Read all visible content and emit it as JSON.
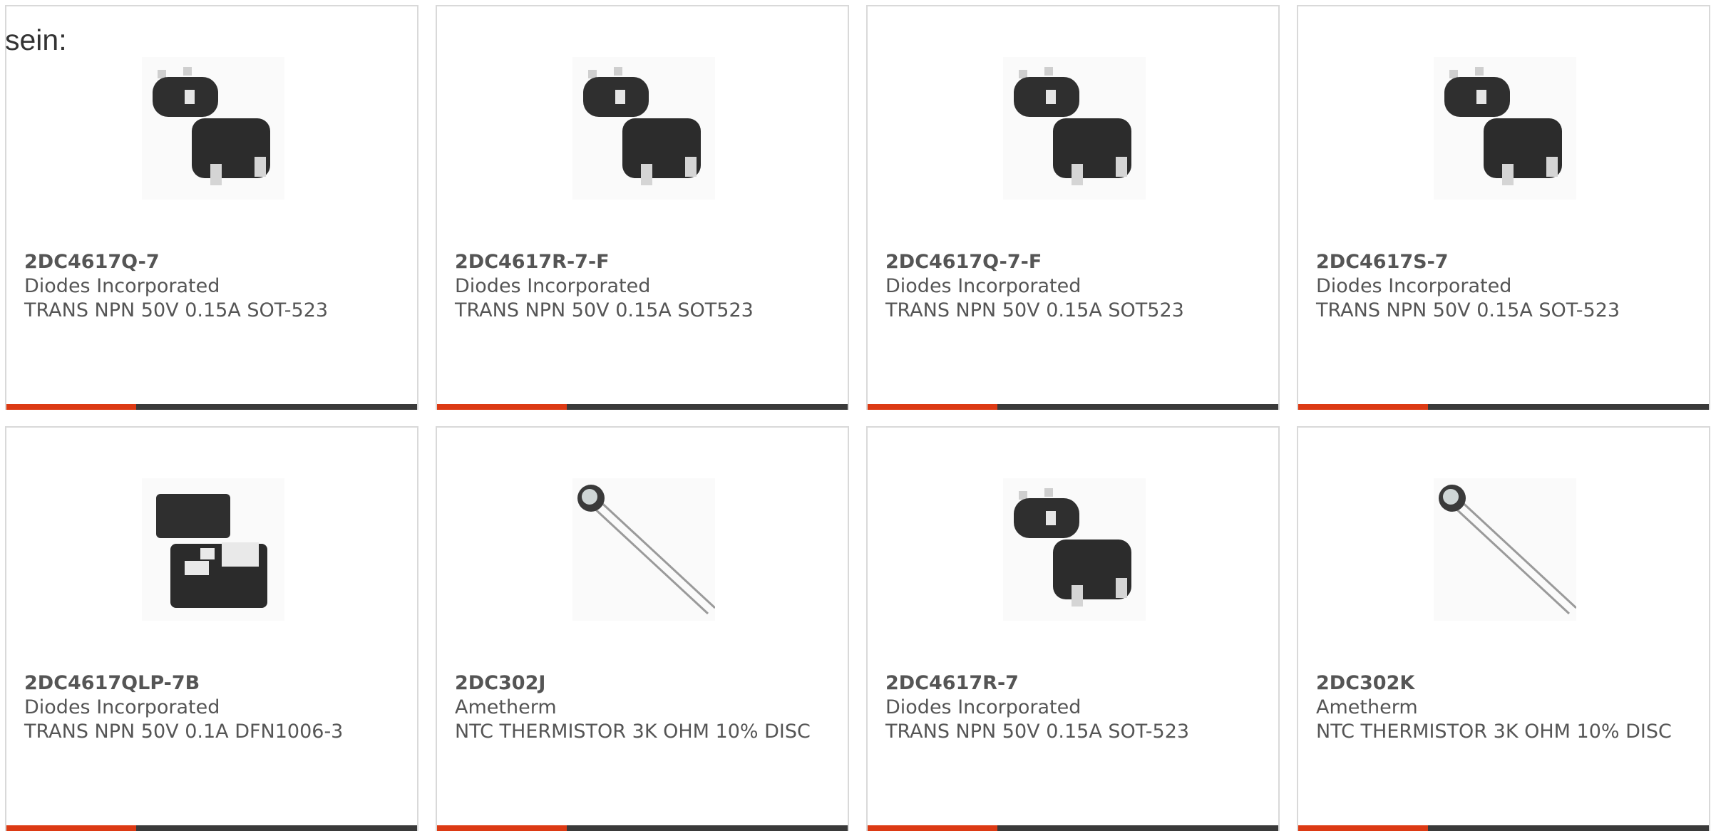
{
  "intro_text": "sein:",
  "accent_color": "#dc3a14",
  "bar_color": "#3a3a3a",
  "products": [
    {
      "part": "2DC4617Q-7",
      "manufacturer": "Diodes Incorporated",
      "description": "TRANS NPN 50V 0.15A SOT-523",
      "image": "sot523-transistor-icon"
    },
    {
      "part": "2DC4617R-7-F",
      "manufacturer": "Diodes Incorporated",
      "description": "TRANS NPN 50V 0.15A SOT523",
      "image": "sot523-transistor-icon"
    },
    {
      "part": "2DC4617Q-7-F",
      "manufacturer": "Diodes Incorporated",
      "description": "TRANS NPN 50V 0.15A SOT523",
      "image": "sot523-transistor-icon"
    },
    {
      "part": "2DC4617S-7",
      "manufacturer": "Diodes Incorporated",
      "description": "TRANS NPN 50V 0.15A SOT-523",
      "image": "sot523-transistor-icon"
    },
    {
      "part": "2DC4617QLP-7B",
      "manufacturer": "Diodes Incorporated",
      "description": "TRANS NPN 50V 0.1A DFN1006-3",
      "image": "dfn1006-package-icon"
    },
    {
      "part": "2DC302J",
      "manufacturer": "Ametherm",
      "description": "NTC THERMISTOR 3K OHM 10% DISC",
      "image": "disc-thermistor-icon"
    },
    {
      "part": "2DC4617R-7",
      "manufacturer": "Diodes Incorporated",
      "description": "TRANS NPN 50V 0.15A SOT-523",
      "image": "sot523-transistor-icon"
    },
    {
      "part": "2DC302K",
      "manufacturer": "Ametherm",
      "description": "NTC THERMISTOR 3K OHM 10% DISC",
      "image": "disc-thermistor-icon"
    }
  ]
}
